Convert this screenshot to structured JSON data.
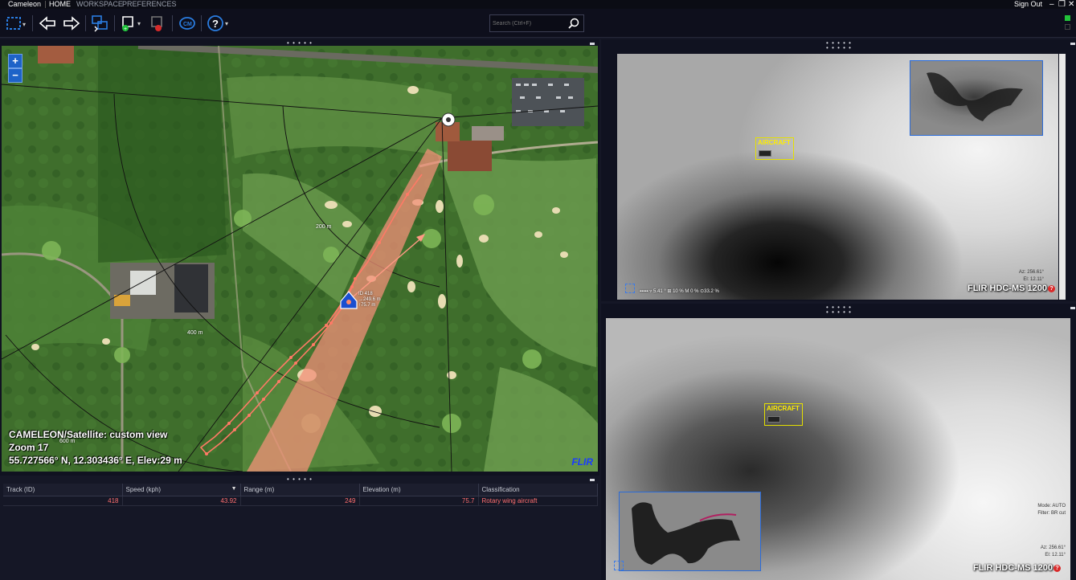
{
  "menubar": {
    "app_title": "Cameleon",
    "items": [
      "HOME",
      "WORKSPACE",
      "PREFERENCES"
    ],
    "sign_out": "Sign Out"
  },
  "toolbar": {
    "search_placeholder": "Search (Ctrl+F)"
  },
  "map": {
    "view_name": "CAMELEON/Satellite: custom view",
    "zoom": "Zoom 17",
    "coords": "55.727566° N, 12.303436° E, Elev:29 m",
    "range_labels": [
      "200 m",
      "400 m",
      "600 m"
    ],
    "track_label": [
      "ID 418",
      "→249.6 m",
      "↑75.7 m"
    ],
    "logo": "FLIR"
  },
  "table": {
    "columns": [
      "Track (ID)",
      "Speed (kph)",
      "Range (m)",
      "Elevation (m)",
      "Classification"
    ],
    "rows": [
      {
        "track": "418",
        "speed": "43.92",
        "range": "249",
        "elevation": "75.7",
        "classification": "Rotary wing aircraft"
      }
    ]
  },
  "cameras": [
    {
      "name": "FLIR HDC-MS 1200",
      "detection_label": "AIRCRAFT",
      "status_text": "▪▪▪▪▪ ▿ 5.41 °   ⊞   10 %          M   0 %   ⊙33.2 %",
      "stats": [
        "Az: 256.61°",
        "El: 12.11°"
      ]
    },
    {
      "name": "FLIR HDC-MS 1200",
      "detection_label": "AIRCRAFT",
      "stats": [
        "Mode: AUTO",
        "Filter: BR cut",
        "Az: 256.61°",
        "El: 12.11°"
      ]
    }
  ],
  "colors": {
    "accent_blue": "#1e63c8",
    "track_red": "#ff6f6f",
    "detect_yellow": "#e5e000",
    "status_green": "#22c33a"
  }
}
